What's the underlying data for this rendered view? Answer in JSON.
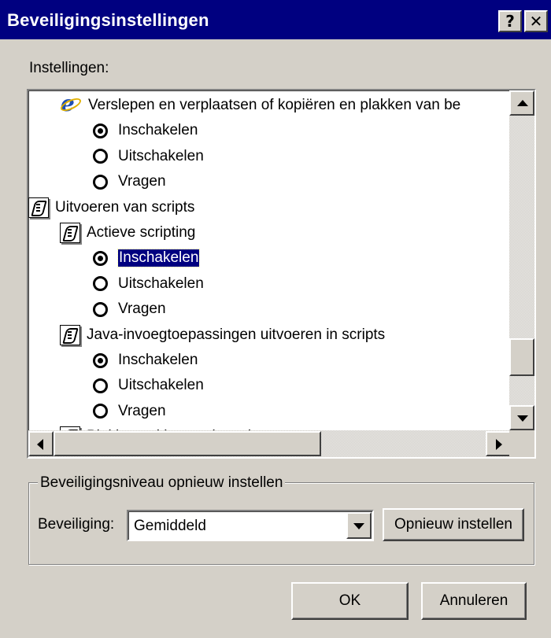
{
  "window": {
    "title": "Beveiligingsinstellingen",
    "help_button": "?",
    "close_button": "✕"
  },
  "settings_label": "Instellingen:",
  "tree": {
    "items": [
      {
        "kind": "setting",
        "icon": "ie-icon",
        "label": "Verslepen en verplaatsen of kopiëren en plakken van be"
      },
      {
        "kind": "option",
        "label": "Inschakelen",
        "checked": true
      },
      {
        "kind": "option",
        "label": "Uitschakelen",
        "checked": false
      },
      {
        "kind": "option",
        "label": "Vragen",
        "checked": false
      },
      {
        "kind": "category",
        "icon": "script-icon",
        "label": "Uitvoeren van scripts"
      },
      {
        "kind": "setting",
        "icon": "script-icon",
        "label": "Actieve scripting"
      },
      {
        "kind": "option",
        "label": "Inschakelen",
        "checked": true,
        "selected": true
      },
      {
        "kind": "option",
        "label": "Uitschakelen",
        "checked": false
      },
      {
        "kind": "option",
        "label": "Vragen",
        "checked": false
      },
      {
        "kind": "setting",
        "icon": "script-icon",
        "label": "Java-invoegtoepassingen uitvoeren in scripts"
      },
      {
        "kind": "option",
        "label": "Inschakelen",
        "checked": true
      },
      {
        "kind": "option",
        "label": "Uitschakelen",
        "checked": false
      },
      {
        "kind": "option",
        "label": "Vragen",
        "checked": false
      },
      {
        "kind": "setting",
        "icon": "script-icon",
        "label": "Plakbewerkingen via script toestaan"
      }
    ]
  },
  "reset_group": {
    "legend": "Beveiligingsniveau opnieuw instellen",
    "security_label": "Beveiliging:",
    "security_value": "Gemiddeld",
    "reset_button": "Opnieuw instellen"
  },
  "buttons": {
    "ok": "OK",
    "cancel": "Annuleren"
  },
  "colors": {
    "titlebar": "#000080",
    "face": "#d4d0c8",
    "selection": "#000080"
  }
}
